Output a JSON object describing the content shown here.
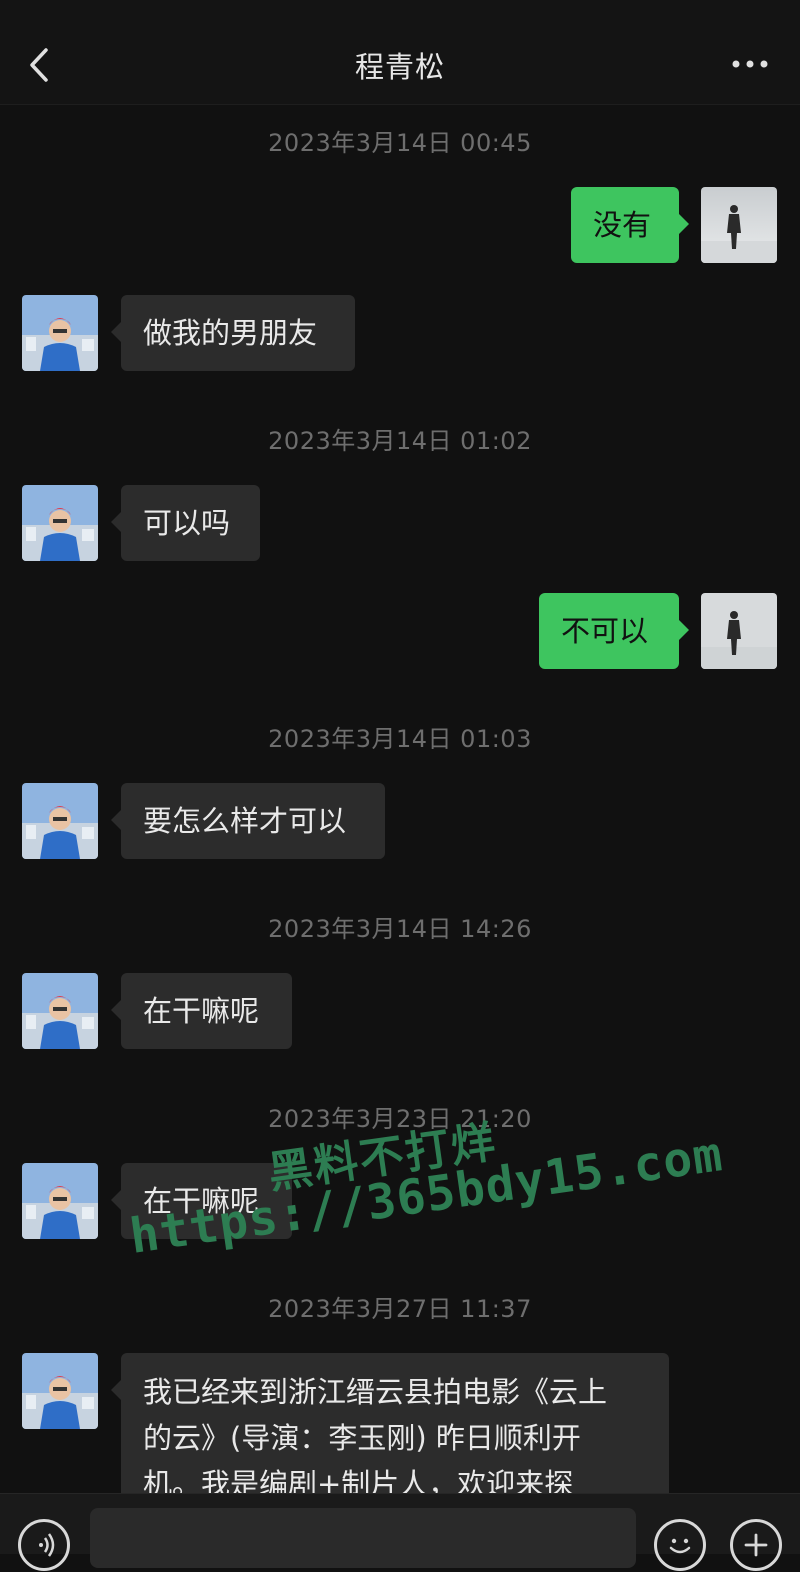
{
  "header": {
    "contact_name": "程青松",
    "back_icon": "chevron-left-icon",
    "more_icon": "more-dots-icon"
  },
  "timestamps": [
    "2023年3月14日 00:45",
    "2023年3月14日 01:02",
    "2023年3月14日 01:03",
    "2023年3月14日 14:26",
    "2023年3月23日 21:20",
    "2023年3月27日 11:37"
  ],
  "messages": [
    {
      "sender": "self",
      "text": "没有"
    },
    {
      "sender": "contact",
      "text": "做我的男朋友"
    },
    {
      "sender": "contact",
      "text": "可以吗"
    },
    {
      "sender": "self",
      "text": "不可以"
    },
    {
      "sender": "contact",
      "text": "要怎么样才可以"
    },
    {
      "sender": "contact",
      "text": "在干嘛呢"
    },
    {
      "sender": "contact",
      "text": "在干嘛呢"
    },
    {
      "sender": "contact",
      "lines": [
        "我已经来到浙江缙云县拍电影《云上",
        "的云》(导演：李玉刚) 昨日顺利开",
        "机。我是编剧+制片人，欢迎来探"
      ]
    }
  ],
  "watermark": {
    "line1": "黑料不打烊",
    "line2": "https://365bdy15.com"
  },
  "input_bar": {
    "input_value": "",
    "voice_icon": "voice-icon",
    "emoji_icon": "emoji-icon",
    "plus_icon": "plus-icon"
  },
  "colors": {
    "background": "#111111",
    "incoming_bubble": "#2c2c2c",
    "outgoing_bubble": "#3ec55f",
    "timestamp": "#6e6e6e",
    "watermark": "#2d7d52"
  }
}
